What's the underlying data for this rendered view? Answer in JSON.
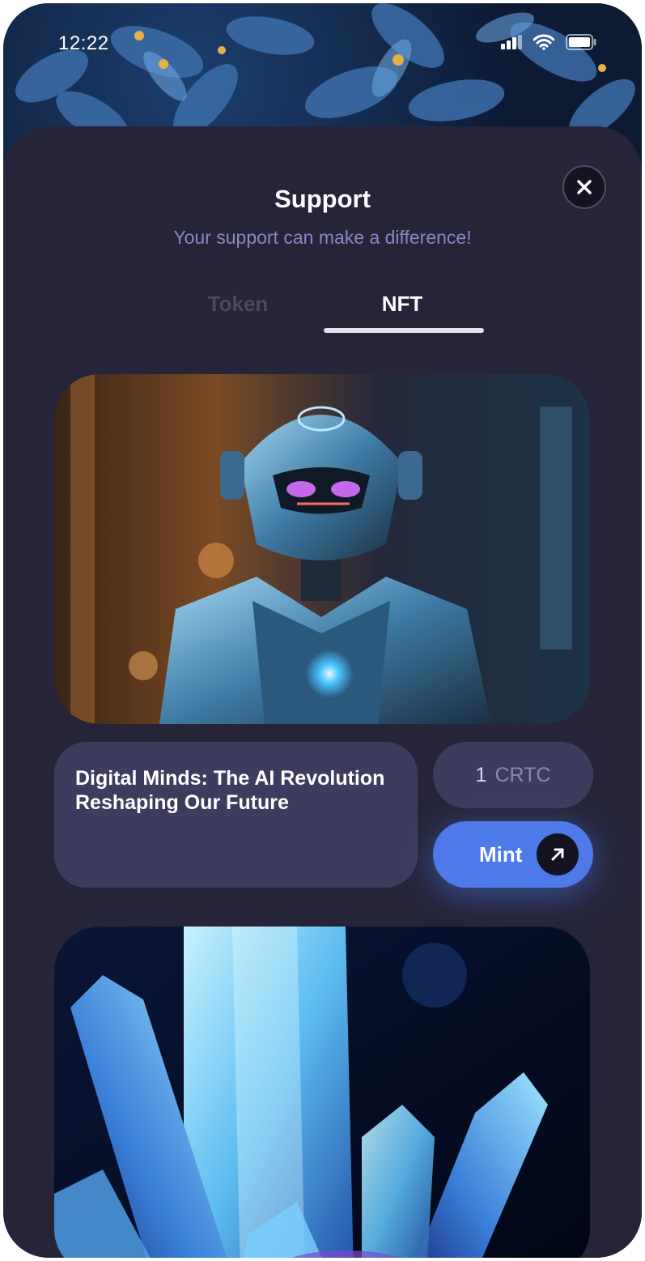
{
  "status_bar": {
    "time": "12:22",
    "icons": [
      "signal-icon",
      "wifi-icon",
      "battery-icon"
    ]
  },
  "sheet": {
    "title": "Support",
    "subtitle": "Your support can make a difference!",
    "close_icon": "close-icon"
  },
  "tabs": [
    {
      "label": "Token",
      "active": false
    },
    {
      "label": "NFT",
      "active": true
    }
  ],
  "nfts": [
    {
      "image": "robot-nft-image",
      "title": "Digital Minds: The AI Revolution Reshaping Our Future",
      "price_amount": "1",
      "price_unit": "CRTC",
      "mint_label": "Mint",
      "mint_icon": "arrow-up-right-icon"
    },
    {
      "image": "crystal-nft-image"
    }
  ],
  "colors": {
    "sheet_bg": "#252439",
    "card_bg": "#3e3c5e",
    "accent": "#4d7ae8",
    "subtitle": "#8c86c4",
    "inactive_tab": "#4a4961"
  }
}
